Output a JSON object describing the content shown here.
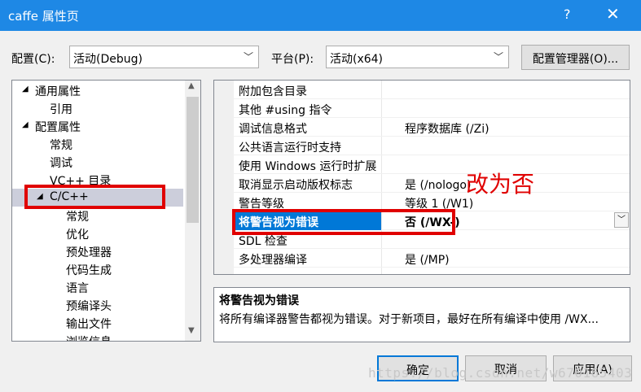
{
  "window": {
    "title": "caffe 属性页",
    "help": "?",
    "close": "✕"
  },
  "config": {
    "label": "配置(C):",
    "value": "活动(Debug)"
  },
  "platform": {
    "label": "平台(P):",
    "value": "活动(x64)"
  },
  "config_manager_button": "配置管理器(O)...",
  "tree": [
    {
      "label": "通用属性",
      "expander": "◢",
      "level": 0
    },
    {
      "label": "引用",
      "level": 1
    },
    {
      "label": "配置属性",
      "expander": "◢",
      "level": 0
    },
    {
      "label": "常规",
      "level": 1
    },
    {
      "label": "调试",
      "level": 1
    },
    {
      "label": "VC++ 目录",
      "level": 1
    },
    {
      "label": "C/C++",
      "expander": "◢",
      "level": 1,
      "selected": true
    },
    {
      "label": "常规",
      "level": 2
    },
    {
      "label": "优化",
      "level": 2
    },
    {
      "label": "预处理器",
      "level": 2
    },
    {
      "label": "代码生成",
      "level": 2
    },
    {
      "label": "语言",
      "level": 2
    },
    {
      "label": "预编译头",
      "level": 2
    },
    {
      "label": "输出文件",
      "level": 2
    },
    {
      "label": "浏览信息",
      "level": 2
    }
  ],
  "properties": [
    {
      "name": "附加包含目录",
      "value": ""
    },
    {
      "name": "其他 #using 指令",
      "value": ""
    },
    {
      "name": "调试信息格式",
      "value": "程序数据库 (/Zi)"
    },
    {
      "name": "公共语言运行时支持",
      "value": ""
    },
    {
      "name": "使用 Windows 运行时扩展",
      "value": ""
    },
    {
      "name": "取消显示启动版权标志",
      "value": "是 (/nologo)"
    },
    {
      "name": "警告等级",
      "value": "等级 1 (/W1)"
    },
    {
      "name": "将警告视为错误",
      "value": "否 (/WX-)",
      "selected": true
    },
    {
      "name": "SDL 检查",
      "value": ""
    },
    {
      "name": "多处理器编译",
      "value": "是 (/MP)"
    }
  ],
  "description": {
    "title": "将警告视为错误",
    "text": "将所有编译器警告都视为错误。对于新项目，最好在所有编译中使用 /WX..."
  },
  "annotation": "改为否",
  "buttons": {
    "ok": "确定",
    "cancel": "取消",
    "apply": "应用(A)"
  },
  "watermark": "https://blog.csdn.net/w670165403",
  "colors": {
    "titlebar": "#1e88e5",
    "selection": "#0078d7",
    "annotation": "#e00000"
  }
}
